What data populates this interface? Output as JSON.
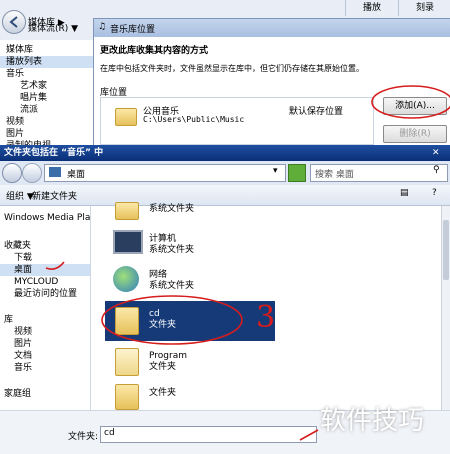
{
  "bg_window": {
    "breadcrumb": "媒体库 ▶",
    "breadcrumb2": "媒体流(R) ▼",
    "tab_play": "播放",
    "tab_burn": "刻录",
    "library_title": "媒体库",
    "playlist": "播放列表",
    "music": "音乐",
    "artist": "艺术家",
    "album": "唱片集",
    "genre": "流派",
    "video": "视频",
    "picture": "图片",
    "tv": "录制的电视"
  },
  "library_dialog": {
    "title": "音乐库位置",
    "heading": "更改此库收集其内容的方式",
    "description": "在库中包括文件夹时，文件虽然显示在库中，但它们仍存储在其原始位置。",
    "section_label": "库位置",
    "location_name": "公用音乐",
    "location_path": "C:\\Users\\Public\\Music",
    "location_status": "默认保存位置",
    "add_button": "添加(A)...",
    "remove_button": "删除(R)"
  },
  "file_dialog": {
    "title": "文件夹包括在 “音乐” 中",
    "address": "桌面",
    "search_placeholder": "搜索 桌面",
    "organize": "组织 ▼",
    "new_folder": "新建文件夹",
    "nav": {
      "wmp": "Windows Media Playe",
      "favorites": "收藏夹",
      "downloads": "下载",
      "desktop": "桌面",
      "mycloud": "MYCLOUD",
      "recent": "最近访问的位置",
      "libraries": "库",
      "videos": "视频",
      "pictures": "图片",
      "documents": "文档",
      "music": "音乐",
      "homegroup": "家庭组"
    },
    "files": [
      {
        "name": "",
        "type": "系统文件夹"
      },
      {
        "name": "计算机",
        "type": "系统文件夹"
      },
      {
        "name": "网络",
        "type": "系统文件夹"
      },
      {
        "name": "cd",
        "type": "文件夹"
      },
      {
        "name": "Program",
        "type": "文件夹"
      },
      {
        "name": "文件夹",
        "type": ""
      }
    ],
    "folder_label": "文件夹:",
    "folder_value": "cd"
  },
  "annotation": "3",
  "watermark": "软件技巧"
}
